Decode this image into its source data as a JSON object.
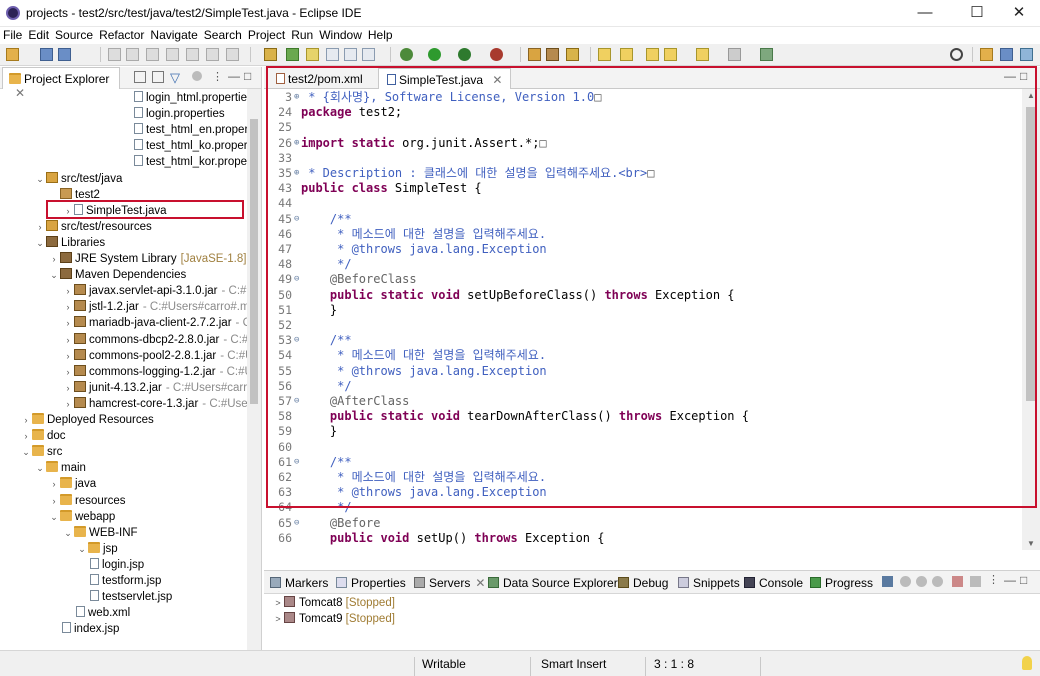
{
  "window": {
    "title": "projects - test2/src/test/java/test2/SimpleTest.java - Eclipse IDE",
    "minimize": "—",
    "maximize": "☐",
    "close": "✕"
  },
  "menu": [
    "File",
    "Edit",
    "Source",
    "Refactor",
    "Navigate",
    "Search",
    "Project",
    "Run",
    "Window",
    "Help"
  ],
  "project_explorer": {
    "tab_label": "Project Explorer",
    "items": [
      {
        "label": "login_html.propertie",
        "type": "file"
      },
      {
        "label": "login.properties",
        "type": "file"
      },
      {
        "label": "test_html_en.propert",
        "type": "file"
      },
      {
        "label": "test_html_ko.propert",
        "type": "file"
      },
      {
        "label": "test_html_kor.proper",
        "type": "file"
      },
      {
        "label": "src/test/java",
        "type": "srcfolder",
        "arrow": "v"
      },
      {
        "label": "test2",
        "type": "package",
        "arrow": ""
      },
      {
        "label": "SimpleTest.java",
        "type": "java",
        "arrow": ">"
      },
      {
        "label": "src/test/resources",
        "type": "srcfolder",
        "arrow": ">"
      },
      {
        "label": "Libraries",
        "type": "lib",
        "arrow": "v"
      },
      {
        "label": "JRE System Library",
        "suffix": "[JavaSE-1.8]",
        "type": "lib",
        "arrow": ">"
      },
      {
        "label": "Maven Dependencies",
        "type": "lib",
        "arrow": "v"
      },
      {
        "label": "javax.servlet-api-3.1.0.jar",
        "suffix": "- C:#U",
        "type": "jar",
        "arrow": ">"
      },
      {
        "label": "jstl-1.2.jar",
        "suffix": "- C:#Users#carro#.m2",
        "type": "jar",
        "arrow": ">"
      },
      {
        "label": "mariadb-java-client-2.7.2.jar",
        "suffix": "- C:",
        "type": "jar",
        "arrow": ">"
      },
      {
        "label": "commons-dbcp2-2.8.0.jar",
        "suffix": "- C:#U",
        "type": "jar",
        "arrow": ">"
      },
      {
        "label": "commons-pool2-2.8.1.jar",
        "suffix": "- C:#U",
        "type": "jar",
        "arrow": ">"
      },
      {
        "label": "commons-logging-1.2.jar",
        "suffix": "- C:#U",
        "type": "jar",
        "arrow": ">"
      },
      {
        "label": "junit-4.13.2.jar",
        "suffix": "- C:#Users#carro",
        "type": "jar",
        "arrow": ">"
      },
      {
        "label": "hamcrest-core-1.3.jar",
        "suffix": "- C:#Users",
        "type": "jar",
        "arrow": ">"
      },
      {
        "label": "Deployed Resources",
        "type": "folder",
        "arrow": ">"
      },
      {
        "label": "doc",
        "type": "folder",
        "arrow": ">"
      },
      {
        "label": "src",
        "type": "folder",
        "arrow": "v"
      },
      {
        "label": "main",
        "type": "folder",
        "arrow": "v"
      },
      {
        "label": "java",
        "type": "folder",
        "arrow": ">"
      },
      {
        "label": "resources",
        "type": "folder",
        "arrow": ">"
      },
      {
        "label": "webapp",
        "type": "folder",
        "arrow": "v"
      },
      {
        "label": "WEB-INF",
        "type": "folder",
        "arrow": "v"
      },
      {
        "label": "jsp",
        "type": "folder",
        "arrow": "v"
      },
      {
        "label": "login.jsp",
        "type": "file"
      },
      {
        "label": "testform.jsp",
        "type": "file"
      },
      {
        "label": "testservlet.jsp",
        "type": "file"
      },
      {
        "label": "web.xml",
        "type": "xml"
      },
      {
        "label": "index.jsp",
        "type": "file"
      }
    ]
  },
  "editor": {
    "tabs": [
      {
        "label": "test2/pom.xml",
        "active": false
      },
      {
        "label": "SimpleTest.java",
        "active": true
      }
    ],
    "lines": [
      {
        "n": "3",
        "fold": "⊕",
        "parts": [
          {
            "t": " * {회사명}, Software License, Version 1.0",
            "c": "cm"
          },
          {
            "t": "□",
            "c": "an"
          }
        ]
      },
      {
        "n": "24",
        "fold": "",
        "parts": [
          {
            "t": "package",
            "c": "kw"
          },
          {
            "t": " test2;",
            "c": ""
          }
        ]
      },
      {
        "n": "25",
        "fold": "",
        "parts": []
      },
      {
        "n": "26",
        "fold": "⊕",
        "parts": [
          {
            "t": "import static",
            "c": "kw"
          },
          {
            "t": " org.junit.Assert.*;",
            "c": ""
          },
          {
            "t": "□",
            "c": "an"
          }
        ]
      },
      {
        "n": "33",
        "fold": "",
        "parts": []
      },
      {
        "n": "35",
        "fold": "⊕",
        "parts": [
          {
            "t": " * Description : 클래스에 대한 설명을 입력해주세요.<br>",
            "c": "jd"
          },
          {
            "t": "□",
            "c": "an"
          }
        ]
      },
      {
        "n": "43",
        "fold": "",
        "parts": [
          {
            "t": "public class",
            "c": "kw"
          },
          {
            "t": " SimpleTest {",
            "c": ""
          }
        ]
      },
      {
        "n": "44",
        "fold": "",
        "parts": []
      },
      {
        "n": "45",
        "fold": "⊖",
        "parts": [
          {
            "t": "    /**",
            "c": "jd"
          }
        ]
      },
      {
        "n": "46",
        "fold": "",
        "parts": [
          {
            "t": "     * 메소드에 대한 설명을 입력해주세요.",
            "c": "jd"
          }
        ]
      },
      {
        "n": "47",
        "fold": "",
        "parts": [
          {
            "t": "     * @throws java.lang.Exception",
            "c": "jd"
          }
        ]
      },
      {
        "n": "48",
        "fold": "",
        "parts": [
          {
            "t": "     */",
            "c": "jd"
          }
        ]
      },
      {
        "n": "49",
        "fold": "⊖",
        "parts": [
          {
            "t": "    @BeforeClass",
            "c": "an"
          }
        ]
      },
      {
        "n": "50",
        "fold": "",
        "parts": [
          {
            "t": "    public static void",
            "c": "kw"
          },
          {
            "t": " setUpBeforeClass() ",
            "c": ""
          },
          {
            "t": "throws",
            "c": "kw"
          },
          {
            "t": " Exception {",
            "c": ""
          }
        ]
      },
      {
        "n": "51",
        "fold": "",
        "parts": [
          {
            "t": "    }",
            "c": ""
          }
        ]
      },
      {
        "n": "52",
        "fold": "",
        "parts": []
      },
      {
        "n": "53",
        "fold": "⊖",
        "parts": [
          {
            "t": "    /**",
            "c": "jd"
          }
        ]
      },
      {
        "n": "54",
        "fold": "",
        "parts": [
          {
            "t": "     * 메소드에 대한 설명을 입력해주세요.",
            "c": "jd"
          }
        ]
      },
      {
        "n": "55",
        "fold": "",
        "parts": [
          {
            "t": "     * @throws java.lang.Exception",
            "c": "jd"
          }
        ]
      },
      {
        "n": "56",
        "fold": "",
        "parts": [
          {
            "t": "     */",
            "c": "jd"
          }
        ]
      },
      {
        "n": "57",
        "fold": "⊖",
        "parts": [
          {
            "t": "    @AfterClass",
            "c": "an"
          }
        ]
      },
      {
        "n": "58",
        "fold": "",
        "parts": [
          {
            "t": "    public static void",
            "c": "kw"
          },
          {
            "t": " tearDownAfterClass() ",
            "c": ""
          },
          {
            "t": "throws",
            "c": "kw"
          },
          {
            "t": " Exception {",
            "c": ""
          }
        ]
      },
      {
        "n": "59",
        "fold": "",
        "parts": [
          {
            "t": "    }",
            "c": ""
          }
        ]
      },
      {
        "n": "60",
        "fold": "",
        "parts": []
      },
      {
        "n": "61",
        "fold": "⊖",
        "parts": [
          {
            "t": "    /**",
            "c": "jd"
          }
        ]
      },
      {
        "n": "62",
        "fold": "",
        "parts": [
          {
            "t": "     * 메소드에 대한 설명을 입력해주세요.",
            "c": "jd"
          }
        ]
      },
      {
        "n": "63",
        "fold": "",
        "parts": [
          {
            "t": "     * @throws java.lang.Exception",
            "c": "jd"
          }
        ]
      },
      {
        "n": "64",
        "fold": "",
        "parts": [
          {
            "t": "     */",
            "c": "jd"
          }
        ]
      },
      {
        "n": "65",
        "fold": "⊖",
        "parts": [
          {
            "t": "    @Before",
            "c": "an"
          }
        ]
      },
      {
        "n": "66",
        "fold": "",
        "parts": [
          {
            "t": "    public void",
            "c": "kw"
          },
          {
            "t": " setUp() ",
            "c": ""
          },
          {
            "t": "throws",
            "c": "kw"
          },
          {
            "t": " Exception {",
            "c": ""
          }
        ]
      }
    ]
  },
  "bottom": {
    "tabs": [
      "Markers",
      "Properties",
      "Servers",
      "Data Source Explorer",
      "Debug",
      "Snippets",
      "Console",
      "Progress"
    ],
    "servers": [
      {
        "name": "Tomcat8",
        "state": "[Stopped]"
      },
      {
        "name": "Tomcat9",
        "state": "[Stopped]"
      }
    ]
  },
  "status": {
    "mode": "Writable",
    "insert": "Smart Insert",
    "position": "3 : 1 : 8"
  },
  "colors": {
    "highlight": "#c8102e",
    "keyword": "#7f0055",
    "comment": "#3f5fbf"
  }
}
